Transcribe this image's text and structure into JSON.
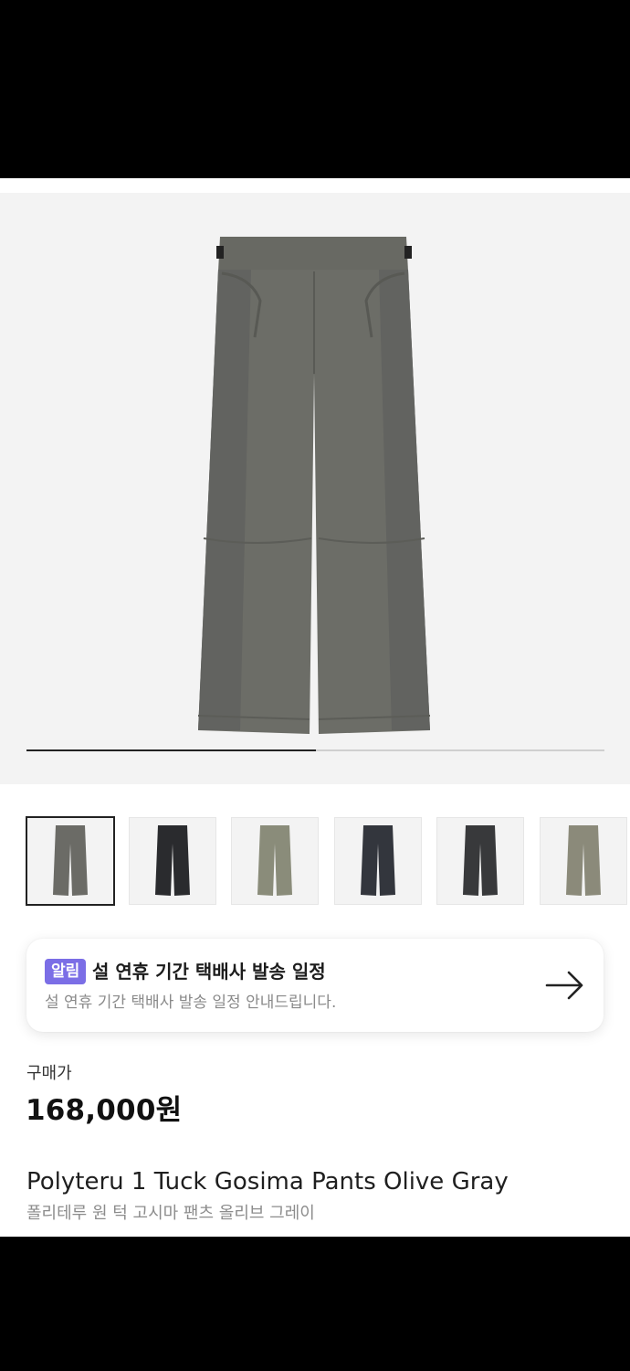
{
  "gallery": {
    "main_image_icon": "pants-product-photo",
    "progress_fraction": 0.5,
    "thumbnails": [
      {
        "color": "#6b6b66",
        "icon": "pants-thumbnail-olive-gray"
      },
      {
        "color": "#2a2b2e",
        "icon": "pants-thumbnail-black"
      },
      {
        "color": "#8a8c7a",
        "icon": "pants-thumbnail-khaki"
      },
      {
        "color": "#33363d",
        "icon": "pants-thumbnail-navy"
      },
      {
        "color": "#38393b",
        "icon": "pants-thumbnail-charcoal"
      },
      {
        "color": "#8b8a7a",
        "icon": "pants-thumbnail-beige-gray"
      }
    ]
  },
  "notice": {
    "badge": "알림",
    "title": "설 연휴 기간 택배사 발송 일정",
    "subtitle": "설 연휴 기간 택배사 발송 일정 안내드립니다.",
    "icon": "arrow-right-icon"
  },
  "price": {
    "label": "구매가",
    "value": "168,000원"
  },
  "product": {
    "name_en": "Polyteru 1 Tuck Gosima Pants Olive Gray",
    "name_ko": "폴리테루 원 턱 고시마 팬츠 올리브 그레이"
  },
  "colors": {
    "accent": "#7b6ee6",
    "pants": "#6b6b66"
  }
}
